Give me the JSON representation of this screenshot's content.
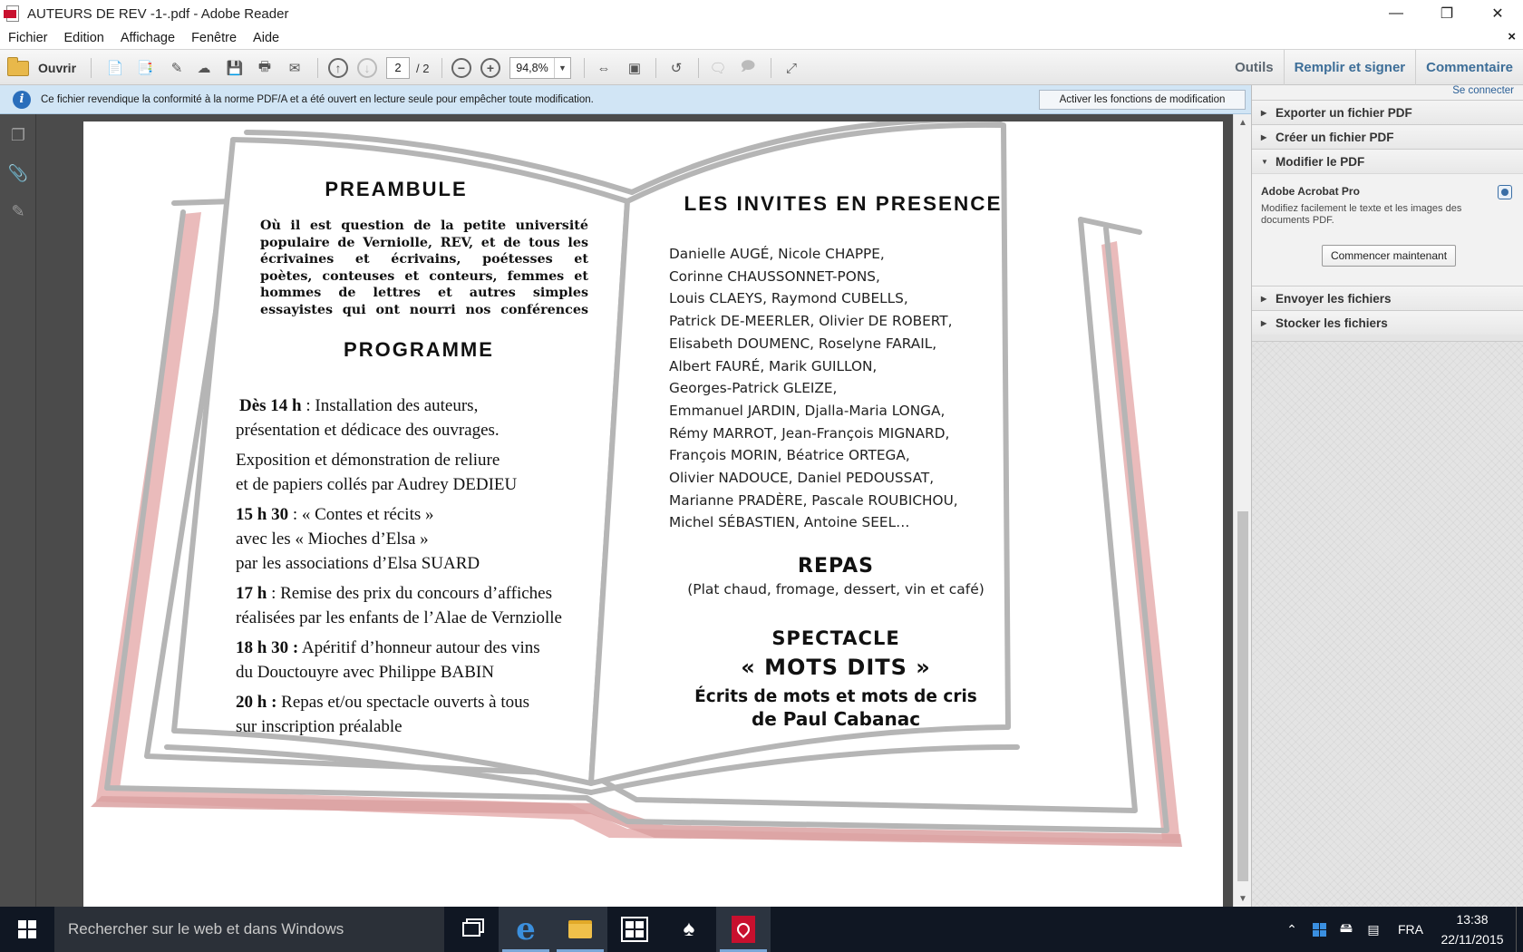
{
  "window": {
    "title": "AUTEURS DE REV -1-.pdf - Adobe Reader"
  },
  "menu": [
    "Fichier",
    "Edition",
    "Affichage",
    "Fenêtre",
    "Aide"
  ],
  "toolbar": {
    "open_label": "Ouvrir",
    "page_current": "2",
    "page_total": "/ 2",
    "zoom": "94,8%",
    "tools": "Outils",
    "fill_sign": "Remplir et signer",
    "comment": "Commentaire"
  },
  "infobar": {
    "message": "Ce fichier revendique la conformité à la norme PDF/A et a été ouvert en lecture seule pour empêcher toute modification.",
    "button": "Activer les fonctions de modification"
  },
  "right_pane": {
    "connect": "Se connecter",
    "sections": [
      {
        "label": "Exporter un fichier PDF"
      },
      {
        "label": "Créer un fichier PDF"
      },
      {
        "label": "Modifier le PDF"
      },
      {
        "label": "Envoyer les fichiers"
      },
      {
        "label": "Stocker les fichiers"
      }
    ],
    "product": "Adobe Acrobat Pro",
    "description": "Modifiez facilement le texte et les images des documents PDF.",
    "start_button": "Commencer maintenant"
  },
  "document": {
    "preamble_title": "PREAMBULE",
    "preamble_lines": [
      "Où il est question de la petite université",
      "populaire de Verniolle, REV, et de tous les",
      "écrivaines et écrivains, poétesses et",
      "poètes, conteuses et conteurs, femmes et",
      "hommes de lettres et autres simples",
      "essayistes qui ont nourri nos conférences"
    ],
    "programme_title": "PROGRAMME",
    "programme": [
      {
        "time": "Dès 14   h",
        "line1": " : Installation des auteurs,",
        "line2": "présentation et dédicace des ouvrages.",
        "line3": ""
      },
      {
        "time": "",
        "line1": "Exposition  et démonstration de reliure",
        "line2": "et de papiers collés par Audrey DEDIEU",
        "line3": ""
      },
      {
        "time": "15 h 30",
        "line1": " : « Contes et récits »",
        "line2": "avec les « Mioches d’Elsa »",
        "line3": "par les associations  d’Elsa SUARD"
      },
      {
        "time": "17 h",
        "line1": " : Remise des prix du concours d’affiches",
        "line2": "réalisées par les enfants de l’Alae de Vernziolle",
        "line3": ""
      },
      {
        "time": "18 h 30  :",
        "line1": " Apéritif d’honneur autour des vins",
        "line2": "du Douctouyre avec Philippe BABIN",
        "line3": ""
      },
      {
        "time": "20 h :",
        "line1": " Repas et/ou spectacle ouverts à tous",
        "line2": "sur inscription préalable",
        "line3": ""
      }
    ],
    "guests_title": "LES INVITES EN PRESENCE",
    "guests_lines": [
      "Danielle AUGÉ,  Nicole CHAPPE,",
      "Corinne CHAUSSONNET-PONS,",
      "Louis CLAEYS, Raymond CUBELLS,",
      "Patrick DE-MEERLER, Olivier DE ROBERT,",
      "Elisabeth DOUMENC, Roselyne FARAIL,",
      "Albert FAURÉ, Marik GUILLON,",
      "Georges-Patrick GLEIZE,",
      "Emmanuel JARDIN, Djalla-Maria LONGA,",
      "Rémy MARROT, Jean-François MIGNARD,",
      "François MORIN, Béatrice ORTEGA,",
      "Olivier NADOUCE, Daniel PEDOUSSAT,",
      "Marianne PRADÈRE, Pascale ROUBICHOU,",
      "Michel SÉBASTIEN, Antoine SEEL…"
    ],
    "meal_title": "REPAS",
    "meal_detail": "(Plat chaud, fromage, dessert, vin et café)",
    "show_title": "SPECTACLE",
    "show_name": "« MOTS DITS »",
    "show_sub1": "Écrits de mots et mots de cris",
    "show_sub2": "de Paul Cabanac"
  },
  "taskbar": {
    "search_placeholder": "Rechercher sur le web et dans Windows",
    "lang": "FRA",
    "time": "13:38",
    "date": "22/11/2015"
  }
}
